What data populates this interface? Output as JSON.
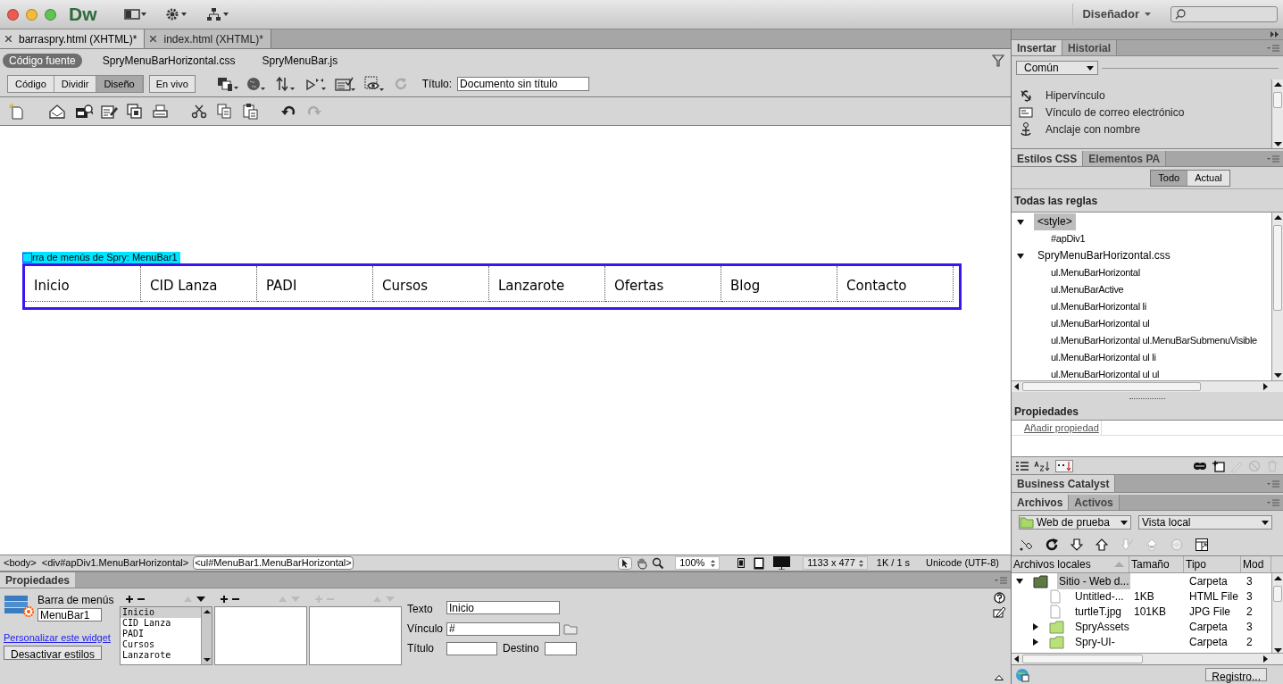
{
  "app": {
    "logo": "Dw",
    "workspace": "Diseñador"
  },
  "doc_tabs": [
    {
      "label": "barraspry.html (XHTML)*",
      "selected": true
    },
    {
      "label": "index.html (XHTML)*",
      "selected": false
    }
  ],
  "related_files": [
    {
      "label": "Código fuente",
      "selected": true
    },
    {
      "label": "SpryMenuBarHorizontal.css",
      "selected": false
    },
    {
      "label": "SpryMenuBar.js",
      "selected": false
    }
  ],
  "view_buttons": [
    {
      "label": "Código",
      "selected": false
    },
    {
      "label": "Dividir",
      "selected": false
    },
    {
      "label": "Diseño",
      "selected": true
    }
  ],
  "live_button": "En vivo",
  "title_field": {
    "label": "Título:",
    "value": "Documento sin título"
  },
  "design": {
    "widget_label": "rra de menús de Spry: MenuBar1",
    "menu_items": [
      "Inicio",
      "CID Lanza",
      "PADI",
      "Cursos",
      "Lanzarote",
      "Ofertas",
      "Blog",
      "Contacto"
    ]
  },
  "tag_selector": [
    {
      "label": "<body>",
      "selected": false
    },
    {
      "label": "<div#apDiv1.MenuBarHorizontal>",
      "selected": false
    },
    {
      "label": "<ul#MenuBar1.MenuBarHorizontal>",
      "selected": true
    }
  ],
  "status": {
    "zoom": "100%",
    "size": "1133 x 477",
    "download": "1K / 1 s",
    "encoding": "Unicode (UTF-8)"
  },
  "properties": {
    "title": "Propiedades",
    "widget_type": "Barra de menús",
    "widget_id": "MenuBar1",
    "customize_link": "Personalizar este widget",
    "disable_styles_button": "Desactivar estilos",
    "items": [
      {
        "label": "Inicio",
        "selected": true
      },
      {
        "label": "CID Lanza",
        "selected": false
      },
      {
        "label": "PADI",
        "selected": false
      },
      {
        "label": "Cursos",
        "selected": false
      },
      {
        "label": "Lanzarote",
        "selected": false
      }
    ],
    "text_label": "Texto",
    "text_value": "Inicio",
    "link_label": "Vínculo",
    "link_value": "#",
    "title_label": "Título",
    "target_label": "Destino"
  },
  "insert_panel": {
    "tabs": [
      {
        "label": "Insertar",
        "selected": true
      },
      {
        "label": "Historial",
        "selected": false
      }
    ],
    "category": "Común",
    "items": [
      "Hipervínculo",
      "Vínculo de correo electrónico",
      "Anclaje con nombre"
    ]
  },
  "css_panel": {
    "tabs": [
      {
        "label": "Estilos CSS",
        "selected": true
      },
      {
        "label": "Elementos PA",
        "selected": false
      }
    ],
    "modes": [
      {
        "label": "Todo",
        "selected": true
      },
      {
        "label": "Actual",
        "selected": false
      }
    ],
    "heading": "Todas las reglas",
    "rules": [
      {
        "label": "<style>",
        "selected": true,
        "expanded": true,
        "children": [
          {
            "label": "#apDiv1",
            "selected": false
          }
        ]
      },
      {
        "label": "SpryMenuBarHorizontal.css",
        "selected": false,
        "expanded": true,
        "children": [
          {
            "label": "ul.MenuBarHorizontal",
            "selected": false
          },
          {
            "label": "ul.MenuBarActive",
            "selected": false
          },
          {
            "label": "ul.MenuBarHorizontal li",
            "selected": false
          },
          {
            "label": "ul.MenuBarHorizontal ul",
            "selected": false
          },
          {
            "label": "ul.MenuBarHorizontal ul.MenuBarSubmenuVisible",
            "selected": false
          },
          {
            "label": "ul.MenuBarHorizontal ul li",
            "selected": false
          },
          {
            "label": "ul.MenuBarHorizontal ul ul",
            "selected": false
          }
        ]
      }
    ],
    "properties_heading": "Propiedades",
    "add_property": "Añadir propiedad"
  },
  "business_catalyst": {
    "title": "Business Catalyst"
  },
  "files_panel": {
    "tabs": [
      {
        "label": "Archivos",
        "selected": true
      },
      {
        "label": "Activos",
        "selected": false
      }
    ],
    "site": "Web de prueba",
    "view": "Vista local",
    "columns": [
      "Archivos locales",
      "Tamaño",
      "Tipo",
      "Mod"
    ],
    "rows": [
      {
        "kind": "site",
        "name": "Sitio - Web d...",
        "type": "Carpeta",
        "mod": "3",
        "selected": true,
        "expanded": true,
        "children": [
          {
            "kind": "file",
            "name": "Untitled-...",
            "size": "1KB",
            "type": "HTML File",
            "mod": "3",
            "selected": false
          },
          {
            "kind": "file",
            "name": "turtleT.jpg",
            "size": "101KB",
            "type": "JPG File",
            "mod": "2",
            "selected": false
          },
          {
            "kind": "folder",
            "name": "SpryAssets",
            "type": "Carpeta",
            "mod": "3",
            "selected": false,
            "expanded": false
          },
          {
            "kind": "folder",
            "name": "Spry-UI-",
            "type": "Carpeta",
            "mod": "2",
            "selected": false,
            "expanded": false
          }
        ]
      }
    ],
    "log_button": "Registro..."
  }
}
